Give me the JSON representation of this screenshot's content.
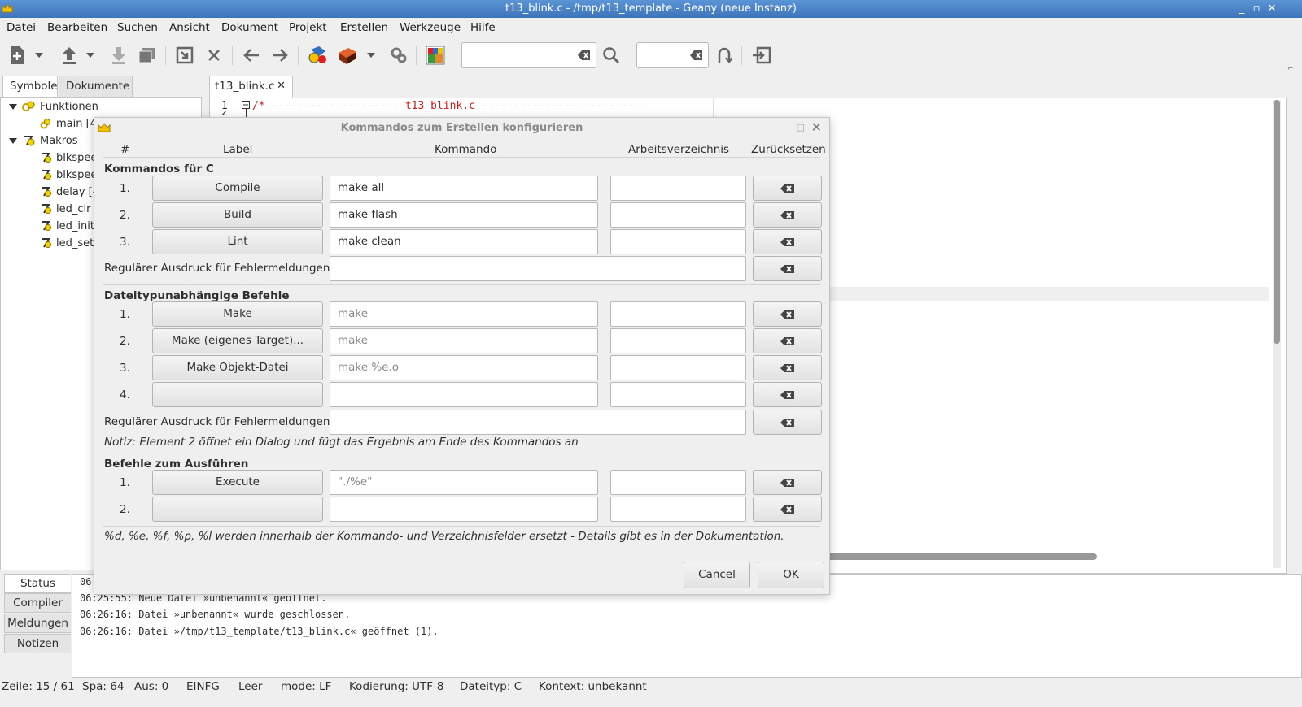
{
  "window": {
    "title": "t13_blink.c - /tmp/t13_template - Geany (neue Instanz)",
    "buttons": [
      "minimize",
      "maximize",
      "close"
    ]
  },
  "menu": [
    "Datei",
    "Bearbeiten",
    "Suchen",
    "Ansicht",
    "Dokument",
    "Projekt",
    "Erstellen",
    "Werkzeuge",
    "Hilfe"
  ],
  "toolbar": {
    "icons": [
      "new-file-icon",
      "open-file-icon",
      "save-icon",
      "save-all-icon",
      "revert-icon",
      "close-icon",
      "back-icon",
      "forward-icon",
      "compile-icon",
      "build-icon",
      "preferences-icon",
      "color-chooser-icon",
      "search-icon",
      "jump-to-line-icon",
      "quit-icon"
    ],
    "search_value": "",
    "goto_value": ""
  },
  "sidebar": {
    "tabs": [
      "Symbole",
      "Dokumente"
    ],
    "active_tab": "Symbole",
    "tree": [
      {
        "label": "Funktionen",
        "group": true
      },
      {
        "label": "main [4",
        "group": false
      },
      {
        "label": "Makros",
        "group": true
      },
      {
        "label": "blkspee",
        "group": false
      },
      {
        "label": "blkspee",
        "group": false
      },
      {
        "label": "delay [4",
        "group": false
      },
      {
        "label": "led_clr [",
        "group": false
      },
      {
        "label": "led_init",
        "group": false
      },
      {
        "label": "led_set",
        "group": false
      }
    ]
  },
  "editor": {
    "tab_label": "t13_blink.c",
    "line_number": "1",
    "line_number_2": "2",
    "line_text": "/* -------------------- t13_blink.c -------------------------"
  },
  "messages": {
    "tabs": [
      "Status",
      "Compiler",
      "Meldungen",
      "Notizen"
    ],
    "active_tab": "Status",
    "lines": [
      "06:25:55: Neue Datei »unbenannt« geöffnet.",
      "06:26:16: Datei »unbenannt« wurde geschlossen.",
      "06:26:16: Datei »/tmp/t13_template/t13_blink.c« geöffnet (1)."
    ],
    "partial_top": "06"
  },
  "statusbar": {
    "line": "Zeile: 15 / 61",
    "col": "Spa: 64",
    "sel": "Aus: 0",
    "mode_ins": "EINFG",
    "indent": "Leer",
    "eol": "mode: LF",
    "encoding": "Kodierung: UTF-8",
    "filetype": "Dateityp: C",
    "context": "Kontext: unbekannt"
  },
  "dialog": {
    "title": "Kommandos zum Erstellen konfigurieren",
    "col_headers": {
      "num": "#",
      "label": "Label",
      "command": "Kommando",
      "workdir": "Arbeitsverzeichnis",
      "reset": "Zurücksetzen"
    },
    "section_c": {
      "title": "Kommandos für C",
      "rows": [
        {
          "num": "1.",
          "label": "Compile",
          "command": "make all",
          "command_placeholder": false,
          "workdir": ""
        },
        {
          "num": "2.",
          "label": "Build",
          "command": "make flash",
          "command_placeholder": false,
          "workdir": ""
        },
        {
          "num": "3.",
          "label": "Lint",
          "command": "make clean",
          "command_placeholder": false,
          "workdir": ""
        }
      ],
      "regex_label": "Regulärer Ausdruck für Fehlermeldungen:",
      "regex_value": ""
    },
    "section_indep": {
      "title": "Dateitypunabhängige Befehle",
      "rows": [
        {
          "num": "1.",
          "label": "Make",
          "command": "make",
          "command_placeholder": true,
          "workdir": ""
        },
        {
          "num": "2.",
          "label": "Make (eigenes Target)...",
          "command": "make",
          "command_placeholder": true,
          "workdir": ""
        },
        {
          "num": "3.",
          "label": "Make Objekt-Datei",
          "command": "make %e.o",
          "command_placeholder": true,
          "workdir": ""
        },
        {
          "num": "4.",
          "label": "",
          "command": "",
          "command_placeholder": false,
          "workdir": ""
        }
      ],
      "regex_label": "Regulärer Ausdruck für Fehlermeldungen:",
      "regex_value": "",
      "note": "Notiz: Element 2 öffnet ein Dialog und fügt das Ergebnis am Ende des Kommandos an"
    },
    "section_exec": {
      "title": "Befehle zum Ausführen",
      "rows": [
        {
          "num": "1.",
          "label": "Execute",
          "command": "\"./%e\"",
          "command_placeholder": true,
          "workdir": ""
        },
        {
          "num": "2.",
          "label": "",
          "command": "",
          "command_placeholder": false,
          "workdir": ""
        }
      ]
    },
    "footer_note": "%d, %e, %f, %p, %l werden innerhalb der Kommando- und Verzeichnisfelder ersetzt - Details gibt es in der Dokumentation.",
    "cancel_label": "Cancel",
    "ok_label": "OK"
  }
}
